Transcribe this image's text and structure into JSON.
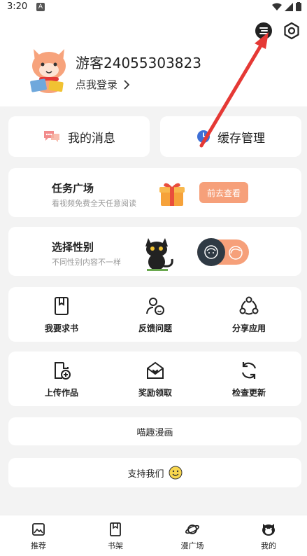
{
  "status_bar": {
    "time": "3:20",
    "notification_badge": "A"
  },
  "header": {
    "user_name": "游客24055303823",
    "login_link": "点我登录",
    "icons": [
      "night-mode-icon",
      "settings-icon"
    ]
  },
  "quick_actions": {
    "messages_label": "我的消息",
    "cache_label": "缓存管理"
  },
  "task": {
    "title": "任务广场",
    "subtitle": "看视频免费全天任意阅读",
    "button_label": "前去查看"
  },
  "gender": {
    "title": "选择性别",
    "subtitle": "不同性别内容不一样"
  },
  "grid_row1": [
    {
      "label": "我要求书",
      "icon": "book-request-icon"
    },
    {
      "label": "反馈问题",
      "icon": "feedback-icon"
    },
    {
      "label": "分享应用",
      "icon": "share-icon"
    }
  ],
  "grid_row2": [
    {
      "label": "上传作品",
      "icon": "upload-icon"
    },
    {
      "label": "奖励领取",
      "icon": "reward-icon"
    },
    {
      "label": "检查更新",
      "icon": "refresh-icon"
    }
  ],
  "text_rows": {
    "app_name": "喵趣漫画",
    "support": "支持我们"
  },
  "bottom_nav": [
    {
      "label": "推荐",
      "icon": "recommend-icon"
    },
    {
      "label": "书架",
      "icon": "bookshelf-icon"
    },
    {
      "label": "漫广场",
      "icon": "planet-icon"
    },
    {
      "label": "我的",
      "icon": "cat-profile-icon"
    }
  ],
  "colors": {
    "accent": "#f6a07a",
    "annotation_arrow": "#e53935",
    "toggle_knob": "#2f3a44"
  }
}
